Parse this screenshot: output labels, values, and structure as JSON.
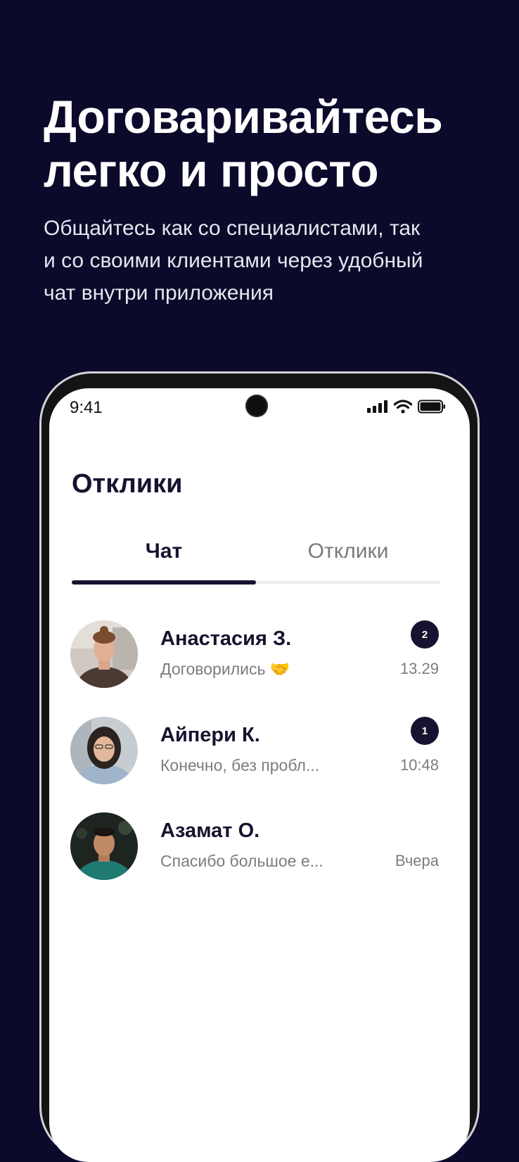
{
  "promo": {
    "title": "Договаривайтесь\nлегко и просто",
    "subtitle": "Общайтесь как со специалистами, так\nи со своими клиентами через удобный\nчат внутри приложения"
  },
  "status_bar": {
    "time": "9:41"
  },
  "screen": {
    "title": "Отклики",
    "tabs": [
      {
        "label": "Чат",
        "active": true
      },
      {
        "label": "Отклики",
        "active": false
      }
    ]
  },
  "chats": [
    {
      "name": "Анастасия З.",
      "preview": "Договорились 🤝",
      "time": "13.29",
      "unread": "2"
    },
    {
      "name": "Айпери К.",
      "preview": "Конечно, без пробл...",
      "time": "10:48",
      "unread": "1"
    },
    {
      "name": "Азамат О.",
      "preview": "Спасибо большое е...",
      "time": "Вчера",
      "unread": ""
    }
  ],
  "colors": {
    "background": "#0c0a2b",
    "accent": "#15132f",
    "muted_text": "#7d7d80"
  },
  "icons": [
    "signal-icon",
    "wifi-icon",
    "battery-icon"
  ]
}
